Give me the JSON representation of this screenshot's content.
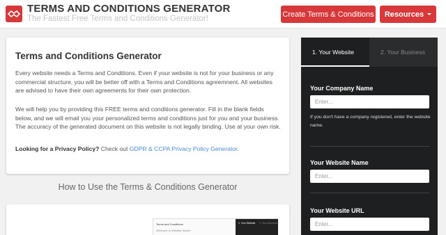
{
  "header": {
    "brand_title": "TERMS AND CONDITIONS GENERATOR",
    "brand_subtitle": "The Fastest Free Terms and Conditions Generator!",
    "create_button": "Create Terms & Conditions",
    "resources_button": "Resources",
    "accent_color": "#d9383a"
  },
  "intro": {
    "title": "Terms and Conditions Generator",
    "paragraph1": "Every website needs a Terms and Conditions. Even if your website is not for your business or any commercial structure, you will be better off with a Terms and Conditions agreemnent. All websites are advised to have their own agreements for their own protection.",
    "paragraph2": "We will help you by providing this FREE terms and conditions generator. Fill in the blank fields below, and we will email you your personalized terms and conditions just for you and your business. The accuracy of the generated document on this website is not legally binding. Use at your own risk.",
    "privacy_lead": "Looking for a Privacy Policy?",
    "privacy_text": " Check out ",
    "privacy_link": "GDPR & CCPA Privacy Policy Generator",
    "privacy_end": "."
  },
  "how_to": {
    "heading": "How to Use the Terms & Conditions Generator",
    "preview_title": "Terms and Conditions",
    "preview_sub": "Welcome to Website Name!",
    "preview_tab1": "1. Your Website",
    "preview_tab2": "2. Your Business"
  },
  "form": {
    "tabs": [
      {
        "label": "1. Your Website",
        "active": true
      },
      {
        "label": "2. Your Business",
        "active": false
      }
    ],
    "company_label": "Your Company Name",
    "company_placeholder": "Enter...",
    "company_help": "If you don't have a company registered, enter the website name.",
    "website_name_label": "Your Website Name",
    "website_name_placeholder": "Enter...",
    "website_url_label": "Your Website URL",
    "website_url_placeholder": "Enter..."
  }
}
